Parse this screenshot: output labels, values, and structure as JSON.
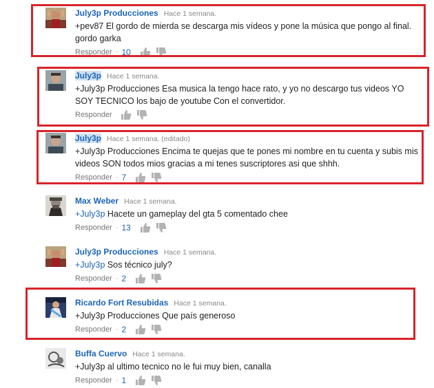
{
  "comments": [
    {
      "author": "July3p Producciones",
      "time": "Hace 1 semana.",
      "mention": "",
      "text": "+pev87 El gordo de mierda se descarga mis vídeos y pone la música que pongo al final. gordo garka",
      "reply_label": "Responder",
      "likes": "10",
      "avatar": "person-photo-avatar"
    },
    {
      "author": "July3p",
      "time": "Hace 1 semana.",
      "mention": "",
      "text": "+July3p Producciones Esa musica la tengo hace rato, y yo no descargo tus videos YO SOY TECNICO los bajo de youtube Con el convertidor.",
      "reply_label": "Responder",
      "likes": "",
      "avatar": "man-photo-avatar"
    },
    {
      "author": "July3p",
      "time": "Hace 1 semana. (editado)",
      "mention": "",
      "text": "+July3p Producciones Encima te quejas que te pones mi nombre en tu cuenta y subis mis videos SON todos mios gracias a mi tenes suscriptores asi que shhh.",
      "reply_label": "Responder",
      "likes": "7",
      "avatar": "man-photo-avatar"
    },
    {
      "author": "Max Weber",
      "time": "Hace 1 semana.",
      "mention": "+July3p",
      "text": "Hacete un gameplay del gta 5 comentado chee",
      "reply_label": "Responder",
      "likes": "13",
      "avatar": "portrait-photo-avatar"
    },
    {
      "author": "July3p Producciones",
      "time": "Hace 1 semana.",
      "mention": "+July3p",
      "text": "Sos técnico july?",
      "reply_label": "Responder",
      "likes": "2",
      "avatar": "person-photo-avatar"
    },
    {
      "author": "Ricardo Fort Resubidas",
      "time": "Hace 1 semana.",
      "mention": "",
      "text": "+July3p Producciones Que país generoso",
      "reply_label": "Responder",
      "likes": "2",
      "avatar": "stage-photo-avatar"
    },
    {
      "author": "Buffa Cuervo",
      "time": "Hace 1 semana.",
      "mention": "",
      "text": "+July3p al ultimo tecnico no le fui muy bien, canalla",
      "reply_label": "Responder",
      "likes": "1",
      "avatar": "sketch-avatar"
    }
  ],
  "icons": {
    "like": "thumb-up-icon",
    "dislike": "thumb-down-icon"
  },
  "colors": {
    "author": "#1b64b8",
    "highlight_box": "#d8232a",
    "author_highlight_bg": "#cfe0f3"
  }
}
